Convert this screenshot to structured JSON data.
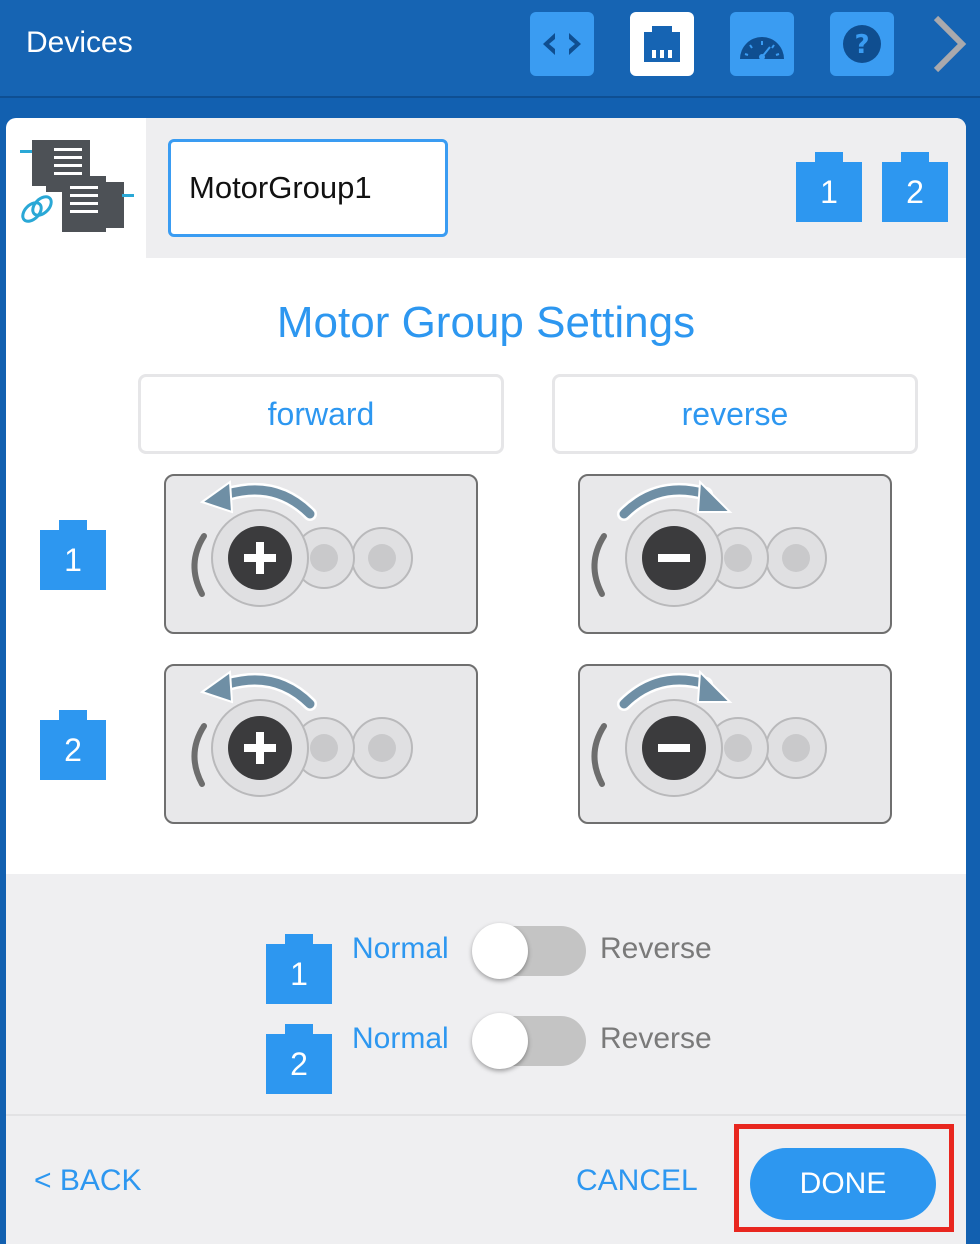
{
  "topbar": {
    "title": "Devices",
    "icons": [
      "code-icon",
      "ethernet-port-icon",
      "dashboard-gauge-icon",
      "help-icon",
      "chevron-right-icon"
    ]
  },
  "colors": {
    "accent": "#2d97f0",
    "topbar": "#1664b3",
    "highlight": "#e8261f"
  },
  "device": {
    "name": "MotorGroup1",
    "ports": [
      "1",
      "2"
    ]
  },
  "settings": {
    "title": "Motor Group Settings",
    "forward_label": "forward",
    "reverse_label": "reverse",
    "rows": [
      {
        "port": "1"
      },
      {
        "port": "2"
      }
    ]
  },
  "toggles": [
    {
      "port": "1",
      "normal": "Normal",
      "reverse": "Reverse",
      "state": "Normal"
    },
    {
      "port": "2",
      "normal": "Normal",
      "reverse": "Reverse",
      "state": "Normal"
    }
  ],
  "footer": {
    "back": "< BACK",
    "cancel": "CANCEL",
    "done": "DONE"
  }
}
